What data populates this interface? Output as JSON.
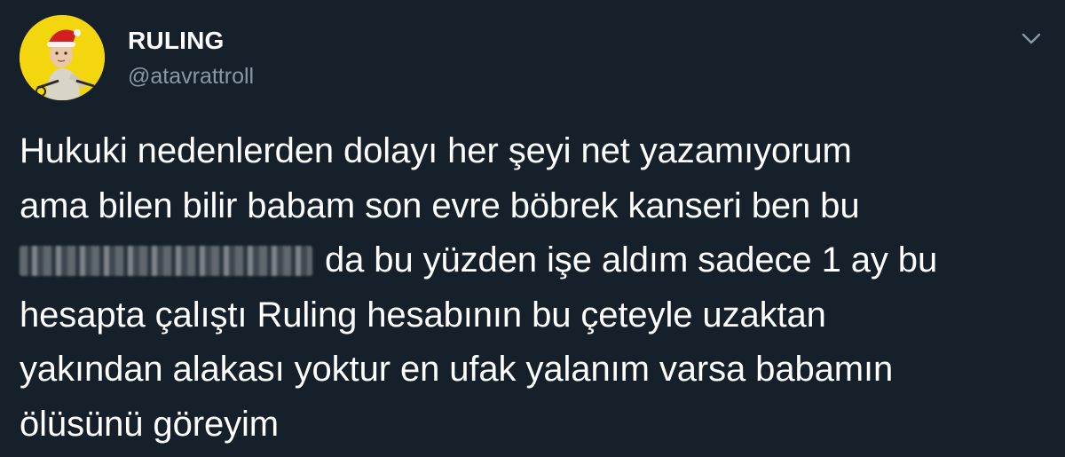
{
  "tweet": {
    "author": {
      "display_name": "RULING",
      "handle": "@atavrattroll",
      "avatar_icon": "profile-photo-avatar",
      "avatar_bg": "#f3d60e"
    },
    "menu_icon": "chevron-down-icon",
    "text": {
      "line1": "Hukuki nedenlerden dolayı her şeyi net yazamıyorum",
      "line2": "ama bilen bilir babam son evre böbrek kanseri ben bu",
      "line3_after_redaction": "da bu yüzden işe aldım sadece 1 ay bu",
      "line4": "hesapta çalıştı Ruling hesabının bu çeteyle uzaktan",
      "line5": "yakından alakası yoktur en ufak yalanım varsa babamın",
      "line6": "ölüsünü göreyim"
    },
    "colors": {
      "background": "#15202b",
      "text": "#ffffff",
      "secondary_text": "#8899a6"
    }
  }
}
